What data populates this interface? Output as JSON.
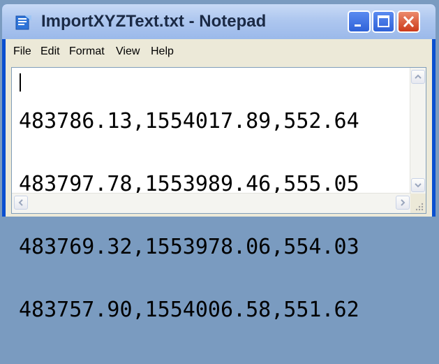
{
  "window": {
    "title": "ImportXYZText.txt - Notepad",
    "app_icon": "notepad-icon",
    "controls": [
      "minimize-icon",
      "maximize-icon",
      "close-icon"
    ]
  },
  "menu": {
    "file": "File",
    "edit": "Edit",
    "format": "Format",
    "view": "View",
    "help": "Help"
  },
  "document": {
    "lines": [
      "483786.13,1554017.89,552.64",
      "483797.78,1553989.46,555.05",
      "483769.32,1553978.06,554.03",
      "483757.90,1554006.58,551.62"
    ]
  },
  "colors": {
    "title_bar": "#aec7ef",
    "frame_border": "#0a4fd0",
    "close_button": "#cc3b1b",
    "menu_background": "#ece9d8"
  }
}
